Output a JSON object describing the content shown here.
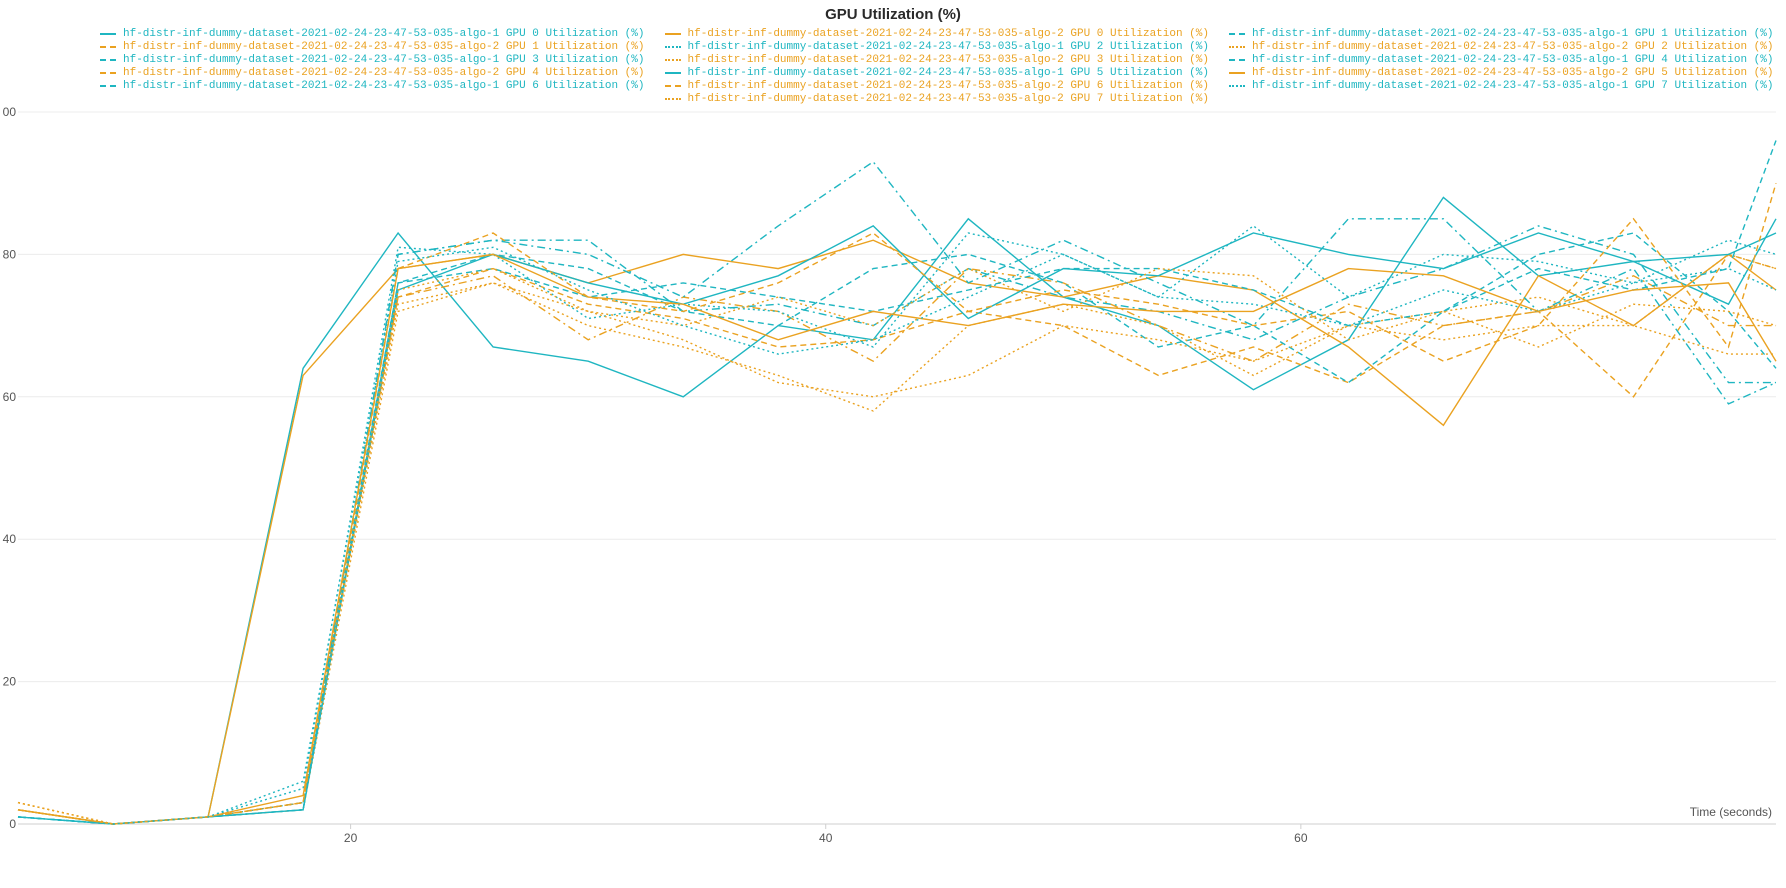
{
  "chart_data": {
    "type": "line",
    "title": "GPU Utilization (%)",
    "xlabel": "Time (seconds)",
    "ylabel": "",
    "xlim": [
      6,
      80
    ],
    "ylim": [
      0,
      100
    ],
    "xticks": [
      20,
      40,
      60
    ],
    "yticks": [
      0,
      20,
      40,
      60,
      80
    ],
    "x": [
      6,
      10,
      14,
      18,
      22,
      26,
      30,
      34,
      38,
      42,
      46,
      50,
      54,
      58,
      62,
      66,
      70,
      74,
      78,
      80
    ],
    "colors": {
      "algo1": "#1fb6c1",
      "algo2": "#eaa221"
    },
    "series": [
      {
        "name": "hf-distr-inf-dummy-dataset-2021-02-24-23-47-53-035-algo-1 GPU 0 Utilization (%)",
        "color": "#1fb6c1",
        "dash": "solid",
        "values": [
          2,
          0,
          1,
          64,
          83,
          67,
          65,
          60,
          70,
          68,
          85,
          74,
          70,
          61,
          68,
          88,
          77,
          79,
          73,
          85
        ]
      },
      {
        "name": "hf-distr-inf-dummy-dataset-2021-02-24-23-47-53-035-algo-2 GPU 1 Utilization (%)",
        "color": "#eaa221",
        "dash": "dash",
        "values": [
          2,
          0,
          1,
          3,
          74,
          78,
          73,
          71,
          67,
          68,
          72,
          70,
          63,
          67,
          62,
          70,
          72,
          60,
          80,
          78
        ]
      },
      {
        "name": "hf-distr-inf-dummy-dataset-2021-02-24-23-47-53-035-algo-1 GPU 3 Utilization (%)",
        "color": "#1fb6c1",
        "dash": "dashdot",
        "values": [
          1,
          0,
          1,
          2,
          80,
          82,
          82,
          72,
          73,
          70,
          78,
          74,
          72,
          68,
          74,
          78,
          84,
          80,
          62,
          62
        ]
      },
      {
        "name": "hf-distr-inf-dummy-dataset-2021-02-24-23-47-53-035-algo-2 GPU 4 Utilization (%)",
        "color": "#eaa221",
        "dash": "dashdot",
        "values": [
          2,
          0,
          1,
          3,
          74,
          77,
          68,
          74,
          72,
          65,
          78,
          76,
          70,
          65,
          73,
          70,
          72,
          77,
          70,
          70
        ]
      },
      {
        "name": "hf-distr-inf-dummy-dataset-2021-02-24-23-47-53-035-algo-1 GPU 6 Utilization (%)",
        "color": "#1fb6c1",
        "dash": "dash",
        "values": [
          1,
          0,
          1,
          3,
          76,
          80,
          78,
          72,
          70,
          78,
          80,
          76,
          67,
          70,
          62,
          72,
          80,
          83,
          72,
          64
        ]
      },
      {
        "name": "hf-distr-inf-dummy-dataset-2021-02-24-23-47-53-035-algo-2 GPU 0 Utilization (%)",
        "color": "#eaa221",
        "dash": "solid",
        "values": [
          2,
          0,
          1,
          63,
          78,
          80,
          76,
          80,
          78,
          82,
          76,
          74,
          77,
          75,
          67,
          56,
          77,
          70,
          80,
          75
        ]
      },
      {
        "name": "hf-distr-inf-dummy-dataset-2021-02-24-23-47-53-035-algo-1 GPU 2 Utilization (%)",
        "color": "#1fb6c1",
        "dash": "dot",
        "values": [
          1,
          0,
          1,
          5,
          81,
          80,
          71,
          73,
          72,
          67,
          83,
          80,
          74,
          73,
          70,
          75,
          72,
          76,
          78,
          75
        ]
      },
      {
        "name": "hf-distr-inf-dummy-dataset-2021-02-24-23-47-53-035-algo-2 GPU 3 Utilization (%)",
        "color": "#eaa221",
        "dash": "dot",
        "values": [
          3,
          0,
          1,
          2,
          72,
          76,
          70,
          67,
          63,
          58,
          70,
          73,
          70,
          63,
          70,
          68,
          70,
          70,
          80,
          78
        ]
      },
      {
        "name": "hf-distr-inf-dummy-dataset-2021-02-24-23-47-53-035-algo-1 GPU 5 Utilization (%)",
        "color": "#1fb6c1",
        "dash": "solid",
        "values": [
          1,
          0,
          1,
          2,
          75,
          80,
          76,
          73,
          77,
          84,
          71,
          78,
          77,
          83,
          80,
          78,
          83,
          79,
          80,
          83
        ]
      },
      {
        "name": "hf-distr-inf-dummy-dataset-2021-02-24-23-47-53-035-algo-2 GPU 6 Utilization (%)",
        "color": "#eaa221",
        "dash": "dash",
        "values": [
          2,
          0,
          1,
          3,
          78,
          83,
          74,
          72,
          76,
          83,
          72,
          75,
          73,
          70,
          72,
          65,
          70,
          85,
          67,
          90
        ]
      },
      {
        "name": "hf-distr-inf-dummy-dataset-2021-02-24-23-47-53-035-algo-2 GPU 7 Utilization (%)",
        "color": "#eaa221",
        "dash": "dot",
        "values": [
          3,
          0,
          1,
          3,
          73,
          76,
          72,
          68,
          62,
          60,
          63,
          70,
          68,
          65,
          70,
          72,
          74,
          70,
          66,
          66
        ]
      },
      {
        "name": "hf-distr-inf-dummy-dataset-2021-02-24-23-47-53-035-algo-1 GPU 1 Utilization (%)",
        "color": "#1fb6c1",
        "dash": "dash",
        "values": [
          1,
          0,
          1,
          2,
          76,
          78,
          74,
          76,
          74,
          72,
          75,
          78,
          78,
          75,
          70,
          72,
          78,
          75,
          78,
          96
        ]
      },
      {
        "name": "hf-distr-inf-dummy-dataset-2021-02-24-23-47-53-035-algo-2 GPU 2 Utilization (%)",
        "color": "#eaa221",
        "dash": "dot",
        "values": [
          3,
          0,
          1,
          3,
          75,
          78,
          72,
          70,
          74,
          70,
          78,
          72,
          78,
          77,
          68,
          72,
          67,
          73,
          72,
          70
        ]
      },
      {
        "name": "hf-distr-inf-dummy-dataset-2021-02-24-23-47-53-035-algo-1 GPU 4 Utilization (%)",
        "color": "#1fb6c1",
        "dash": "dashdot",
        "values": [
          1,
          0,
          1,
          2,
          80,
          82,
          80,
          74,
          84,
          93,
          76,
          82,
          76,
          70,
          85,
          85,
          72,
          78,
          59,
          62
        ]
      },
      {
        "name": "hf-distr-inf-dummy-dataset-2021-02-24-23-47-53-035-algo-2 GPU 5 Utilization (%)",
        "color": "#eaa221",
        "dash": "solid",
        "values": [
          2,
          0,
          1,
          4,
          78,
          80,
          74,
          73,
          68,
          72,
          70,
          73,
          72,
          72,
          78,
          77,
          72,
          75,
          76,
          65
        ]
      },
      {
        "name": "hf-distr-inf-dummy-dataset-2021-02-24-23-47-53-035-algo-1 GPU 7 Utilization (%)",
        "color": "#1fb6c1",
        "dash": "dot",
        "values": [
          1,
          0,
          1,
          6,
          79,
          81,
          75,
          70,
          66,
          68,
          74,
          80,
          74,
          84,
          74,
          80,
          79,
          76,
          82,
          80
        ]
      }
    ],
    "legend_layout": [
      [
        "hf-distr-inf-dummy-dataset-2021-02-24-23-47-53-035-algo-1 GPU 0 Utilization (%)",
        "hf-distr-inf-dummy-dataset-2021-02-24-23-47-53-035-algo-2 GPU 1 Utilization (%)",
        "hf-distr-inf-dummy-dataset-2021-02-24-23-47-53-035-algo-1 GPU 3 Utilization (%)",
        "hf-distr-inf-dummy-dataset-2021-02-24-23-47-53-035-algo-2 GPU 4 Utilization (%)",
        "hf-distr-inf-dummy-dataset-2021-02-24-23-47-53-035-algo-1 GPU 6 Utilization (%)"
      ],
      [
        "hf-distr-inf-dummy-dataset-2021-02-24-23-47-53-035-algo-2 GPU 0 Utilization (%)",
        "hf-distr-inf-dummy-dataset-2021-02-24-23-47-53-035-algo-1 GPU 2 Utilization (%)",
        "hf-distr-inf-dummy-dataset-2021-02-24-23-47-53-035-algo-2 GPU 3 Utilization (%)",
        "hf-distr-inf-dummy-dataset-2021-02-24-23-47-53-035-algo-1 GPU 5 Utilization (%)",
        "hf-distr-inf-dummy-dataset-2021-02-24-23-47-53-035-algo-2 GPU 6 Utilization (%)",
        "hf-distr-inf-dummy-dataset-2021-02-24-23-47-53-035-algo-2 GPU 7 Utilization (%)"
      ],
      [
        "hf-distr-inf-dummy-dataset-2021-02-24-23-47-53-035-algo-1 GPU 1 Utilization (%)",
        "hf-distr-inf-dummy-dataset-2021-02-24-23-47-53-035-algo-2 GPU 2 Utilization (%)",
        "hf-distr-inf-dummy-dataset-2021-02-24-23-47-53-035-algo-1 GPU 4 Utilization (%)",
        "hf-distr-inf-dummy-dataset-2021-02-24-23-47-53-035-algo-2 GPU 5 Utilization (%)",
        "hf-distr-inf-dummy-dataset-2021-02-24-23-47-53-035-algo-1 GPU 7 Utilization (%)"
      ]
    ]
  }
}
